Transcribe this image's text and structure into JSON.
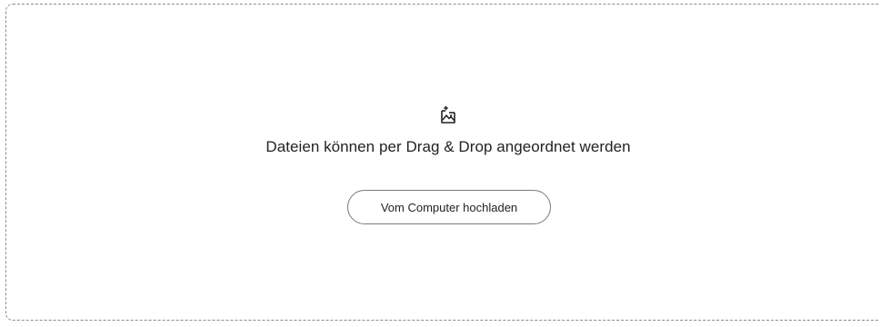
{
  "dropzone": {
    "icon": "add-image-icon",
    "headline": "Dateien können per Drag & Drop angeordnet werden",
    "upload_button_label": "Vom Computer hochladen"
  },
  "colors": {
    "border": "#8c8c8c",
    "text": "#222222",
    "button_border": "#7a7a7a"
  }
}
